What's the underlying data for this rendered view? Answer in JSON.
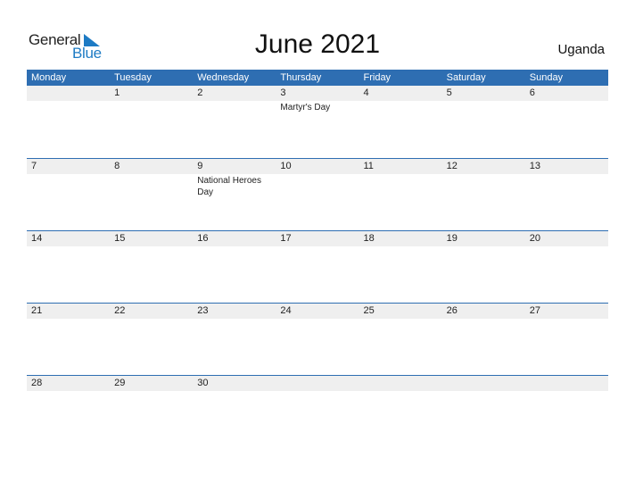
{
  "logo": {
    "general": "General",
    "blue": "Blue",
    "accent": "#1e7bc4"
  },
  "title": "June 2021",
  "country": "Uganda",
  "colors": {
    "header_bg": "#2e6eb2",
    "date_strip_bg": "#efefef"
  },
  "weekdays": [
    "Monday",
    "Tuesday",
    "Wednesday",
    "Thursday",
    "Friday",
    "Saturday",
    "Sunday"
  ],
  "weeks": [
    {
      "days": [
        "",
        "1",
        "2",
        "3",
        "4",
        "5",
        "6"
      ],
      "events": [
        "",
        "",
        "",
        "Martyr's Day",
        "",
        "",
        ""
      ]
    },
    {
      "days": [
        "7",
        "8",
        "9",
        "10",
        "11",
        "12",
        "13"
      ],
      "events": [
        "",
        "",
        "National Heroes Day",
        "",
        "",
        "",
        ""
      ]
    },
    {
      "days": [
        "14",
        "15",
        "16",
        "17",
        "18",
        "19",
        "20"
      ],
      "events": [
        "",
        "",
        "",
        "",
        "",
        "",
        ""
      ]
    },
    {
      "days": [
        "21",
        "22",
        "23",
        "24",
        "25",
        "26",
        "27"
      ],
      "events": [
        "",
        "",
        "",
        "",
        "",
        "",
        ""
      ]
    },
    {
      "days": [
        "28",
        "29",
        "30",
        "",
        "",
        "",
        ""
      ],
      "events": [
        "",
        "",
        "",
        "",
        "",
        "",
        ""
      ]
    }
  ]
}
